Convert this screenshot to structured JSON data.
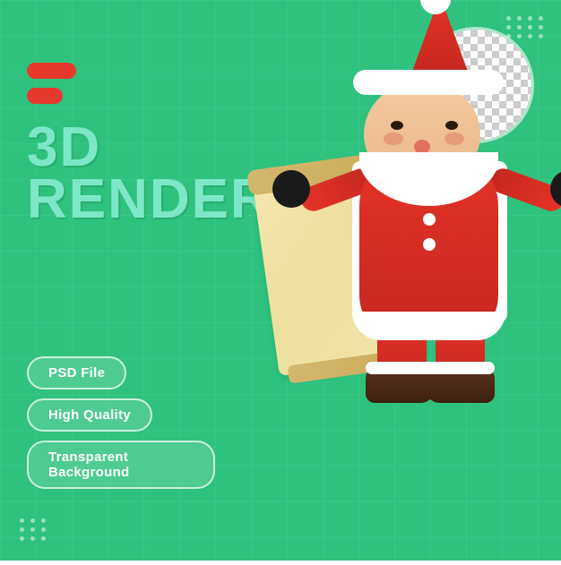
{
  "background": {
    "color": "#2ec27e"
  },
  "title": {
    "line1": "3D",
    "line2": "RENDER"
  },
  "badges": [
    {
      "label": "PSD File"
    },
    {
      "label": "High Quality"
    },
    {
      "label": "Transparent Background"
    }
  ],
  "dots": {
    "top_right_count": 12,
    "bottom_left_count": 9
  },
  "stripes": [
    {
      "label": "stripe-1"
    },
    {
      "label": "stripe-2"
    }
  ],
  "illustration": {
    "type": "3d-santa-render",
    "description": "3D rendered Santa Claus holding a blank scroll paper"
  }
}
